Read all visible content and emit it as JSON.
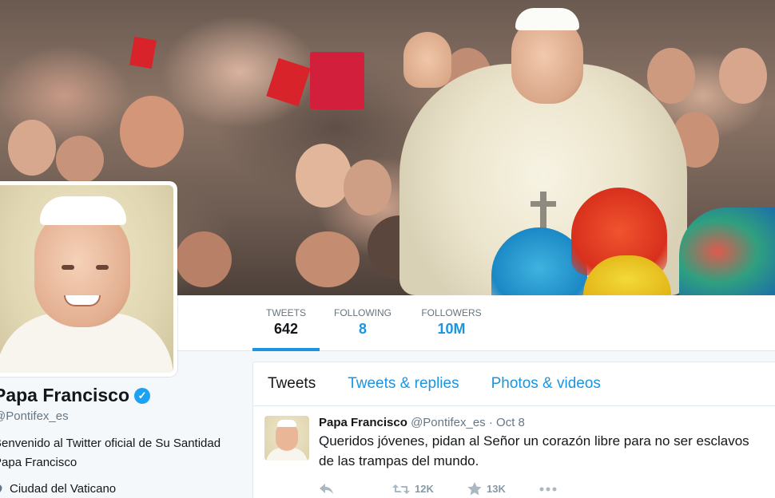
{
  "profile": {
    "name": "Papa Francisco",
    "handle": "@Pontifex_es",
    "bio": "Benvenido al Twitter oficial de Su Santidad Papa Francisco",
    "location": "Ciudad del Vaticano",
    "verified_icon": "verified-check-icon"
  },
  "stats": [
    {
      "label": "TWEETS",
      "value": "642"
    },
    {
      "label": "FOLLOWING",
      "value": "8"
    },
    {
      "label": "FOLLOWERS",
      "value": "10M"
    }
  ],
  "tabs": [
    {
      "label": "Tweets"
    },
    {
      "label": "Tweets & replies"
    },
    {
      "label": "Photos & videos"
    }
  ],
  "tweet": {
    "author": "Papa Francisco",
    "handle": "@Pontifex_es",
    "separator": "·",
    "date": "Oct 8",
    "line1": "Queridos jóvenes, pidan al Señor un corazón libre para no ser esclavos",
    "line2": "de las trampas del mundo.",
    "retweets": "12K",
    "likes": "13K"
  },
  "colors": {
    "accent": "#1b95e0",
    "text": "#14171a",
    "muted": "#657786"
  }
}
